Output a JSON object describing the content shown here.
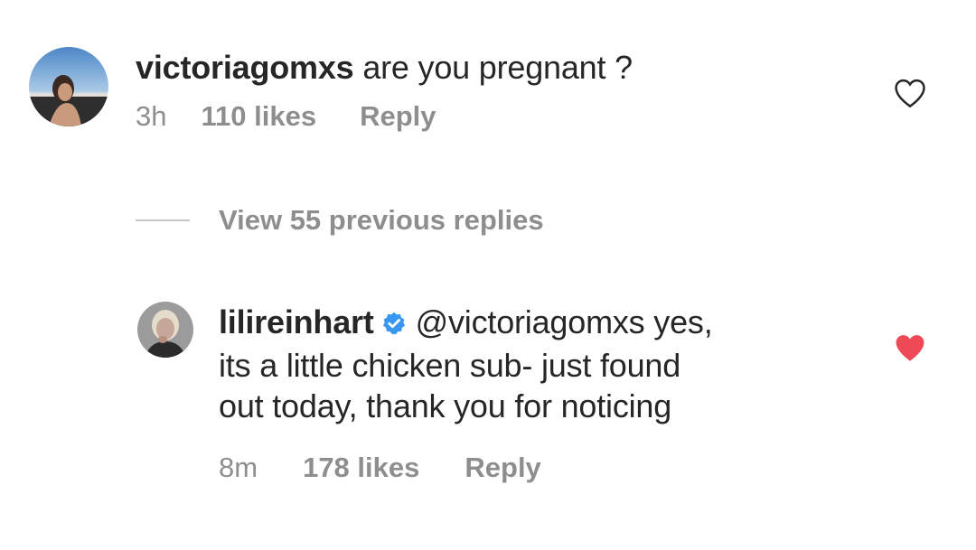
{
  "comments": [
    {
      "username": "victoriagomxs",
      "text": "are you pregnant ?",
      "time": "3h",
      "likes": "110 likes",
      "reply_label": "Reply",
      "liked": false
    },
    {
      "username": "lilireinhart",
      "verified": true,
      "mention": "@victoriagomxs",
      "text_line1": "yes,",
      "text_line2": "its a little chicken sub- just found",
      "text_line3": "out today, thank you for noticing",
      "time": "8m",
      "likes": "178 likes",
      "reply_label": "Reply",
      "liked": true
    }
  ],
  "view_replies_label": "View 55 previous replies",
  "colors": {
    "text": "#262626",
    "muted": "#8e8e8e",
    "heart_liked": "#ed4956",
    "verified": "#3897f0"
  }
}
